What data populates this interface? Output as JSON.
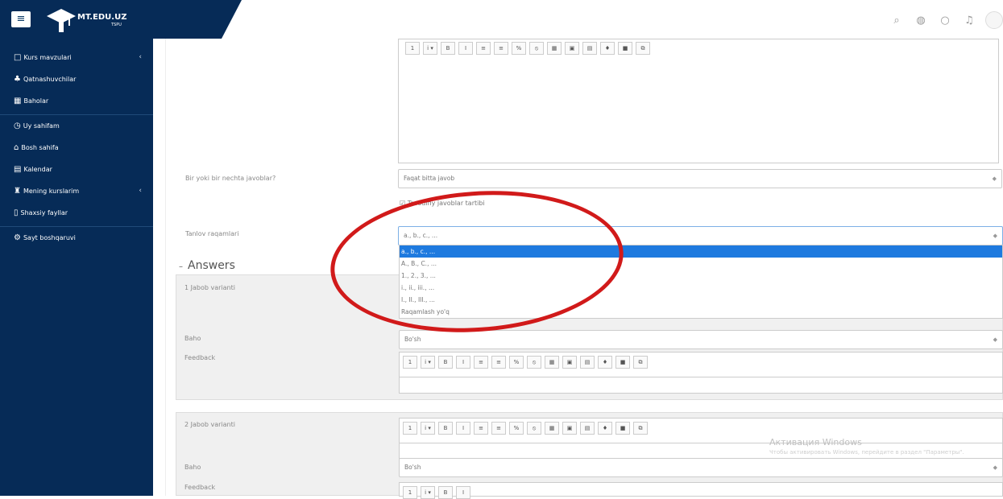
{
  "brand": {
    "title": "MT.EDU.UZ",
    "subtitle": "TSPU",
    "color": "#062b57"
  },
  "header": {
    "icons": [
      "search-icon",
      "globe-icon",
      "chat-icon",
      "bell-icon",
      "avatar"
    ]
  },
  "sidebar": {
    "items": [
      {
        "label": "Kurs mavzulari",
        "icon": "folder-icon",
        "chev": "‹"
      },
      {
        "label": "Qatnashuvchilar",
        "icon": "users-icon"
      },
      {
        "label": "Baholar",
        "icon": "table-icon"
      },
      {
        "label": "Uy sahifam",
        "icon": "clock-icon"
      },
      {
        "label": "Bosh sahifa",
        "icon": "home-icon"
      },
      {
        "label": "Kalendar",
        "icon": "calendar-icon"
      },
      {
        "label": "Mening kurslarim",
        "icon": "graduation-icon",
        "chev": "‹"
      },
      {
        "label": "Shaxsiy fayllar",
        "icon": "file-icon"
      },
      {
        "label": "Sayt boshqaruvi",
        "icon": "gear-icon"
      }
    ]
  },
  "form": {
    "single_label": "Bir yoki bir nechta javoblar?",
    "single_value": "Faqat bitta javob",
    "shuffle_label": "Tasodifiy javoblar tartibi",
    "numbering_label": "Tanlov raqamlari",
    "numbering_value": "a., b., c., ...",
    "numbering_options": [
      "a., b., c., ...",
      "A., B., C., ...",
      "1., 2., 3., ...",
      "i., ii., iii., ...",
      "I., II., III., ...",
      "Raqamlash yo'q"
    ],
    "answers_title": "Answers",
    "answer1_label": "1 Jabob varianti",
    "grade_label": "Baho",
    "grade_value": "Bo'sh",
    "feedback_label": "Feedback",
    "answer2_label": "2 Jabob varianti",
    "grade2_label": "Baho",
    "grade2_value": "Bo'sh",
    "feedback2_label": "Feedback"
  },
  "toolbar": [
    "1",
    "i ▾",
    "B",
    "I",
    "≡",
    "≡",
    "%",
    "⦸",
    "▦",
    "▣",
    "▤",
    "♦",
    "■",
    "⧉"
  ],
  "windows": {
    "title": "Активация Windows",
    "text": "Чтобы активировать Windows, перейдите в раздел \"Параметры\"."
  }
}
